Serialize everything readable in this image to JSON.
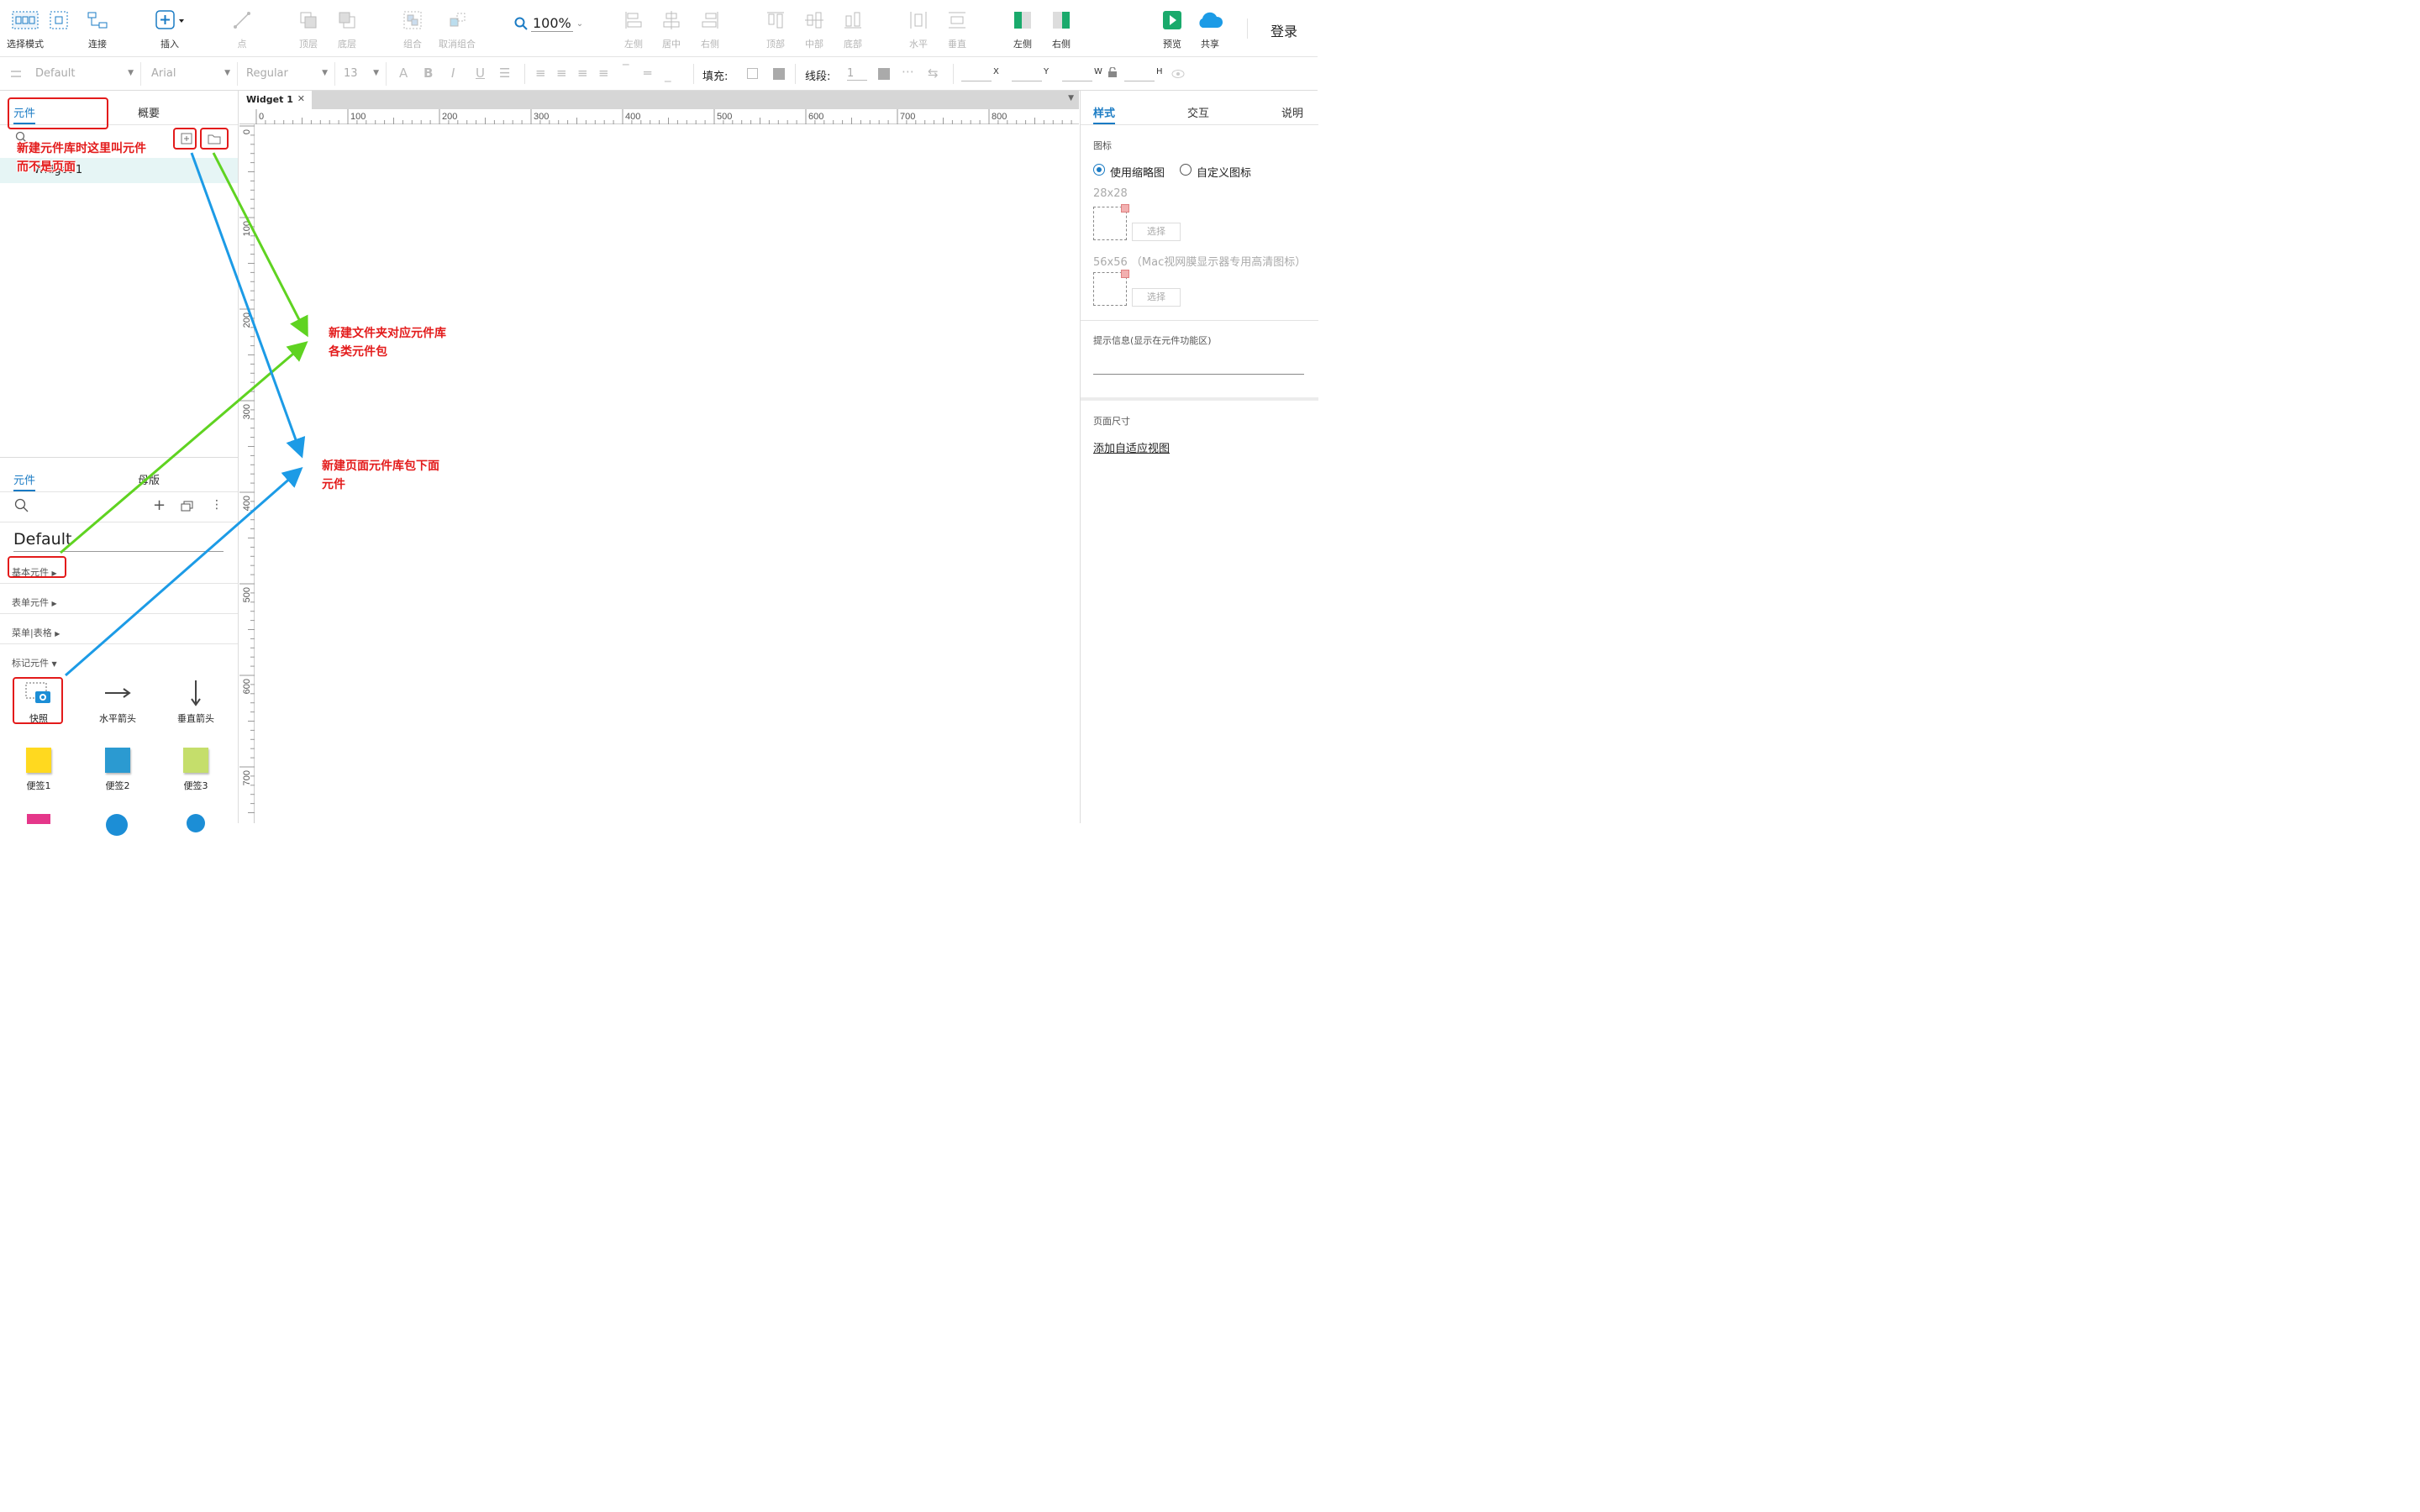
{
  "toolbar": {
    "select_mode": "选择模式",
    "connect": "连接",
    "insert": "插入",
    "point": "点",
    "top_layer": "顶层",
    "bottom_layer": "底层",
    "group": "组合",
    "ungroup": "取消组合",
    "zoom": "100%",
    "align_left": "左侧",
    "align_center": "居中",
    "align_right": "右侧",
    "align_top": "顶部",
    "align_middle": "中部",
    "align_bottom": "底部",
    "dist_h": "水平",
    "dist_v": "垂直",
    "left_panel": "左侧",
    "right_panel": "右侧",
    "preview": "预览",
    "share": "共享",
    "login": "登录"
  },
  "format": {
    "style": "Default",
    "font": "Arial",
    "weight": "Regular",
    "size": "13",
    "fill_label": "填充:",
    "line_label": "线段:",
    "line_value": "1",
    "x": "X",
    "y": "Y",
    "w": "W",
    "h": "H"
  },
  "left_top": {
    "tab_widgets": "元件",
    "tab_outline": "概要",
    "row_item": "Widget 1"
  },
  "left_bottom": {
    "tab_widgets": "元件",
    "tab_masters": "母版",
    "library": "Default",
    "categories": [
      "基本元件",
      "表单元件",
      "菜单|表格",
      "标记元件"
    ],
    "widgets": [
      "快照",
      "水平箭头",
      "垂直箭头",
      "便签1",
      "便签2",
      "便签3"
    ]
  },
  "canvas": {
    "tab": "Widget 1",
    "ruler_h": [
      "0",
      "100",
      "200",
      "300",
      "400",
      "500",
      "600",
      "700",
      "800"
    ],
    "ruler_v": [
      "0",
      "100",
      "200",
      "300",
      "400",
      "500",
      "600",
      "700"
    ]
  },
  "right": {
    "tab_style": "样式",
    "tab_interact": "交互",
    "tab_notes": "说明",
    "icon_label": "图标",
    "use_thumb": "使用缩略图",
    "custom_icon": "自定义图标",
    "size_28": "28x28",
    "size_56": "56x56 （Mac视网膜显示器专用高清图标）",
    "choose": "选择",
    "tooltip_label": "提示信息(显示在元件功能区)",
    "page_size": "页面尺寸",
    "add_view": "添加自适应视图"
  },
  "annotations": {
    "note1": "新建元件库时这里叫元件而不是页面",
    "note2_line1": "新建文件夹对应元件库",
    "note2_line2": "各类元件包",
    "note3_line1": "新建页面元件库包下面",
    "note3_line2": "元件"
  },
  "colors": {
    "accent": "#1a7bc4",
    "annotation_red": "#e31b1b",
    "arrow_green": "#5fd321",
    "arrow_blue": "#1c9be6"
  }
}
